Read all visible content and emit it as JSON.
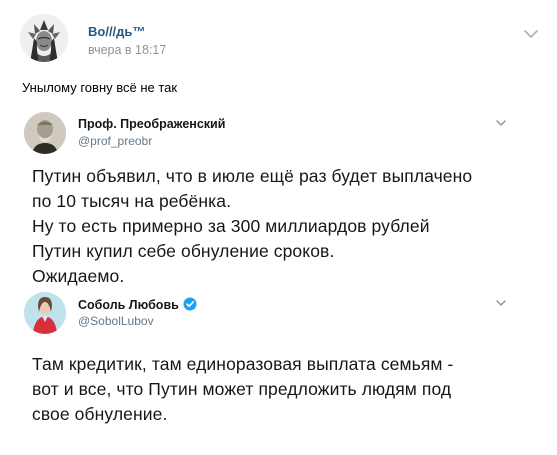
{
  "post": {
    "author": "Bo///дь™",
    "time": "вчера в 18:17",
    "text": "Унылому говну всё не так"
  },
  "tweets": [
    {
      "name": "Проф. Преображенский",
      "handle": "@prof_preobr",
      "verified": false,
      "lines": [
        "Путин объявил, что в июле ещё раз будет выплачено",
        "по 10 тысяч на ребёнка.",
        "Ну то есть примерно за 300 миллиардов рублей",
        "Путин купил себе обнуление сроков.",
        "Ожидаемо."
      ]
    },
    {
      "name": "Соболь Любовь",
      "handle": "@SobolLubov",
      "verified": true,
      "lines": [
        "Там кредитик, там единоразовая выплата семьям -",
        "вот и все, что Путин может предложить людям под",
        "свое обнуление."
      ]
    }
  ],
  "icons": {
    "post_avatar": "native-headdress-portrait",
    "post_menu": "chevron-down-icon",
    "tweet_menu": "chevron-down-icon",
    "verified": "verified-badge-icon"
  },
  "colors": {
    "author_link": "#2a5885",
    "muted": "#939393",
    "tweet_text": "#14171a",
    "tweet_handle": "#657786",
    "verified": "#1da1f2"
  }
}
